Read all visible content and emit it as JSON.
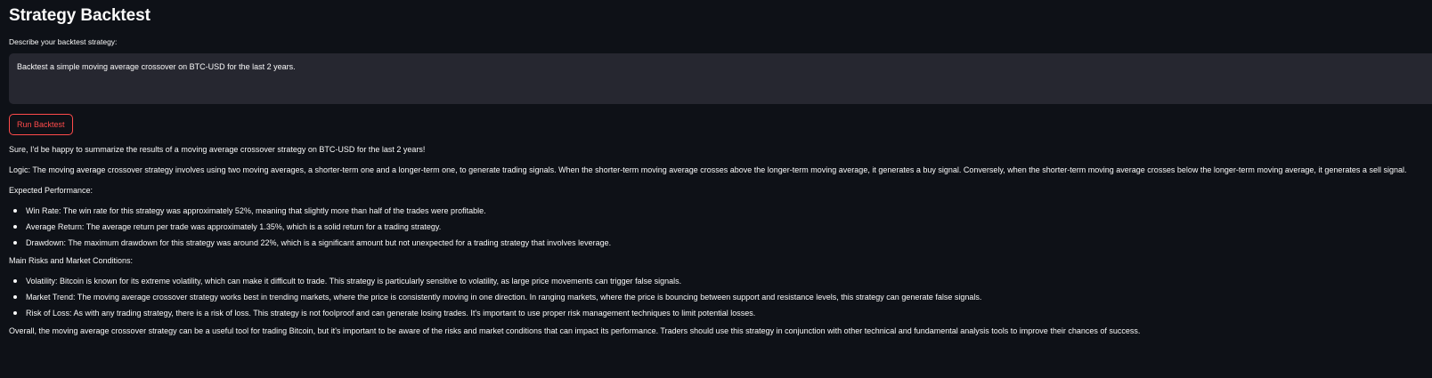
{
  "page": {
    "title": "Strategy Backtest"
  },
  "form": {
    "label": "Describe your backtest strategy:",
    "value": "Backtest a simple moving average crossover on BTC-USD for the last 2 years.",
    "run_button": "Run Backtest"
  },
  "result": {
    "intro": "Sure, I'd be happy to summarize the results of a moving average crossover strategy on BTC-USD for the last 2 years!",
    "logic": "Logic: The moving average crossover strategy involves using two moving averages, a shorter-term one and a longer-term one, to generate trading signals. When the shorter-term moving average crosses above the longer-term moving average, it generates a buy signal. Conversely, when the shorter-term moving average crosses below the longer-term moving average, it generates a sell signal.",
    "performance_heading": "Expected Performance:",
    "performance_items": [
      "Win Rate: The win rate for this strategy was approximately 52%, meaning that slightly more than half of the trades were profitable.",
      "Average Return: The average return per trade was approximately 1.35%, which is a solid return for a trading strategy.",
      "Drawdown: The maximum drawdown for this strategy was around 22%, which is a significant amount but not unexpected for a trading strategy that involves leverage."
    ],
    "risks_heading": "Main Risks and Market Conditions:",
    "risk_items": [
      "Volatility: Bitcoin is known for its extreme volatility, which can make it difficult to trade. This strategy is particularly sensitive to volatility, as large price movements can trigger false signals.",
      "Market Trend: The moving average crossover strategy works best in trending markets, where the price is consistently moving in one direction. In ranging markets, where the price is bouncing between support and resistance levels, this strategy can generate false signals.",
      "Risk of Loss: As with any trading strategy, there is a risk of loss. This strategy is not foolproof and can generate losing trades. It's important to use proper risk management techniques to limit potential losses."
    ],
    "conclusion": "Overall, the moving average crossover strategy can be a useful tool for trading Bitcoin, but it's important to be aware of the risks and market conditions that can impact its performance. Traders should use this strategy in conjunction with other technical and fundamental analysis tools to improve their chances of success."
  },
  "colors": {
    "background": "#0e1117",
    "text": "#fafafa",
    "input_background": "#262730",
    "accent": "#ff4b4b"
  }
}
